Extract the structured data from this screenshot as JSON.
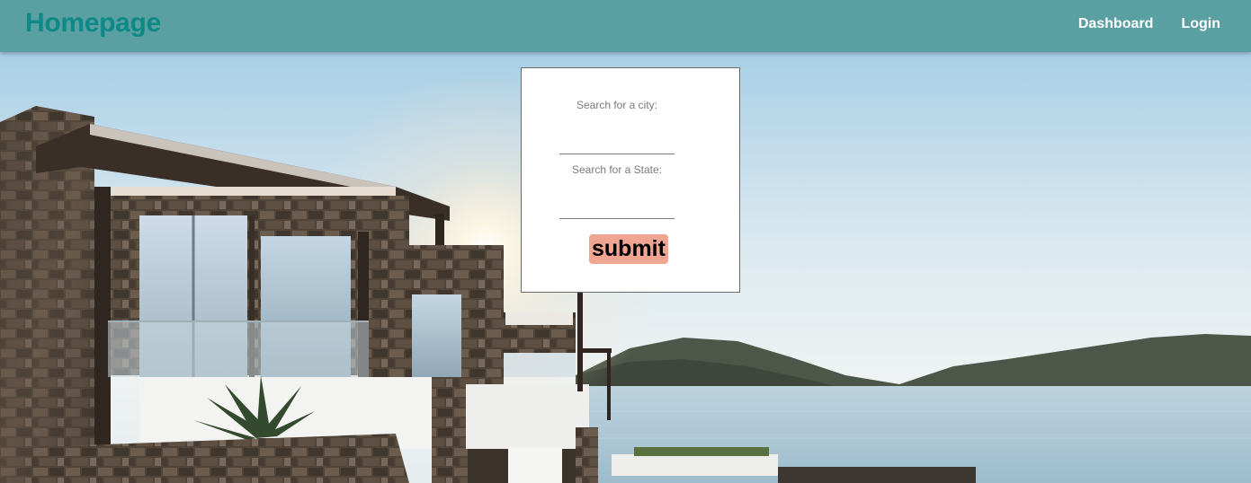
{
  "navbar": {
    "brand": "Homepage",
    "links": [
      {
        "label": "Dashboard"
      },
      {
        "label": "Login"
      }
    ]
  },
  "search_form": {
    "city_label": "Search for a city:",
    "city_value": "",
    "state_label": "Search for a State:",
    "state_value": "",
    "submit_label": "submit"
  },
  "colors": {
    "navbar_bg": "#5a9fa2",
    "brand": "#0e8a86",
    "submit_bg": "#f0a592"
  }
}
